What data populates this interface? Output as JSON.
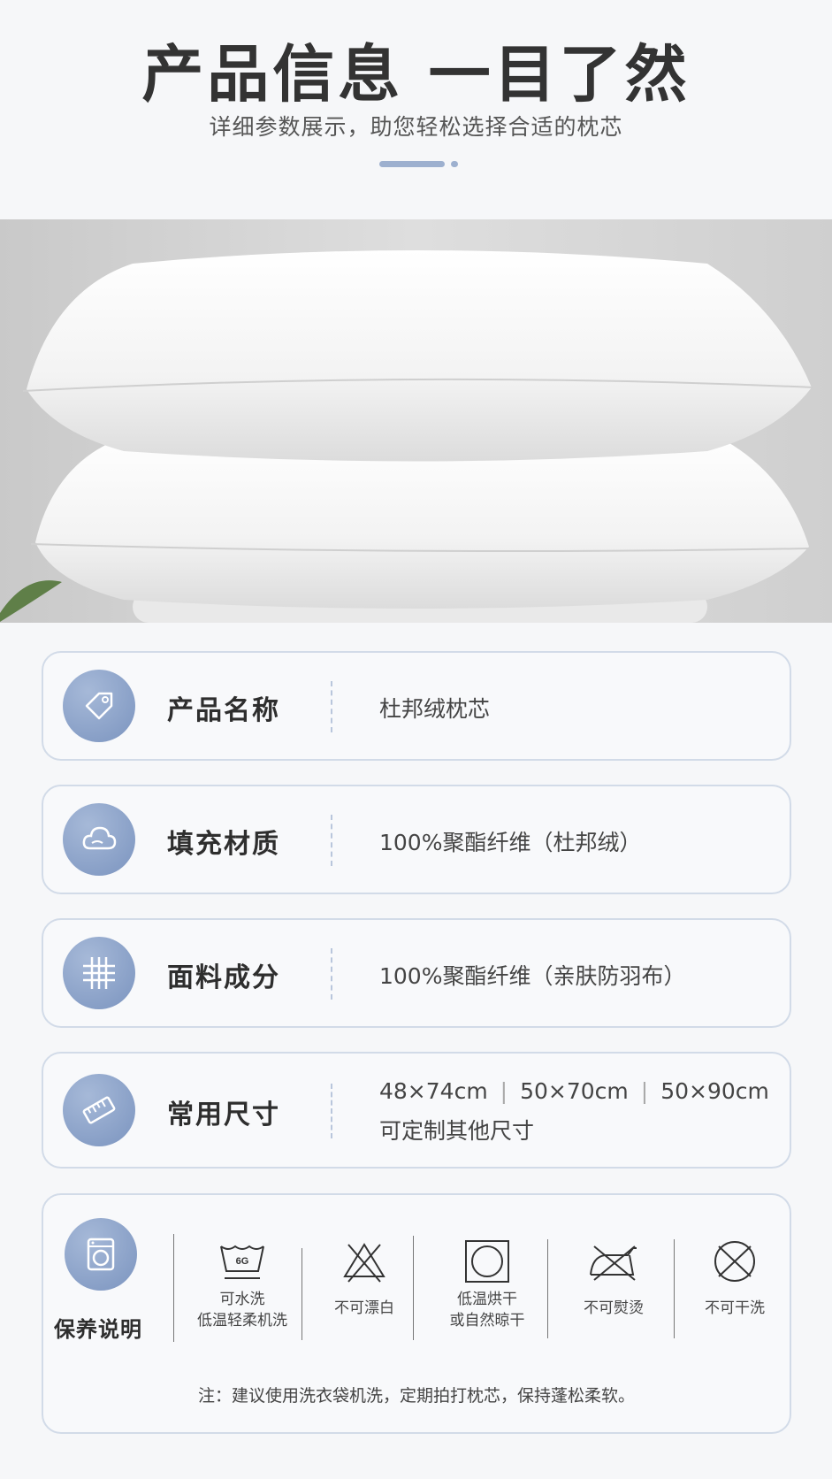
{
  "header": {
    "title": "产品信息 一目了然",
    "subtitle": "详细参数展示，助您轻松选择合适的枕芯"
  },
  "accent_color": "#7f98c2",
  "specs": [
    {
      "icon": "tag-icon",
      "label": "产品名称",
      "value": "杜邦绒枕芯"
    },
    {
      "icon": "cloud-icon",
      "label": "填充材质",
      "value": "100%聚酯纤维（杜邦绒）"
    },
    {
      "icon": "fabric-icon",
      "label": "面料成分",
      "value": "100%聚酯纤维（亲肤防羽布）"
    },
    {
      "icon": "ruler-icon",
      "label": "常用尺寸",
      "sizes": [
        "48×74cm",
        "50×70cm",
        "50×90cm"
      ],
      "sizes_separator": "|",
      "note": "可定制其他尺寸"
    }
  ],
  "care": {
    "icon": "washing-machine-icon",
    "label": "保养说明",
    "items": [
      {
        "icon": "hand-wash-icon",
        "tub_text": "6G",
        "line1": "可水洗",
        "line2": "低温轻柔机洗"
      },
      {
        "icon": "no-bleach-icon",
        "line1": "不可漂白",
        "line2": ""
      },
      {
        "icon": "tumble-dry-low-icon",
        "line1": "低温烘干",
        "line2": "或自然晾干"
      },
      {
        "icon": "no-iron-icon",
        "line1": "不可熨烫",
        "line2": ""
      },
      {
        "icon": "no-dry-clean-icon",
        "line1": "不可干洗",
        "line2": ""
      }
    ],
    "note": "注：建议使用洗衣袋机洗，定期拍打枕芯，保持蓬松柔软。"
  }
}
